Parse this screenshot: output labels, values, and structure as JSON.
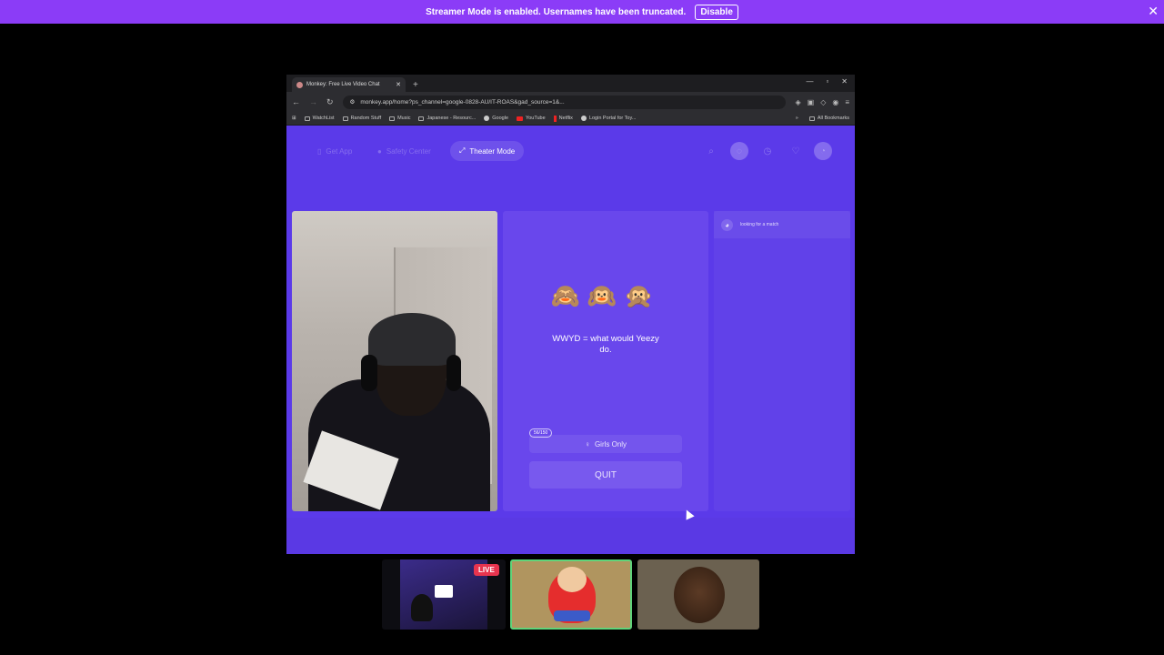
{
  "banner": {
    "message": "Streamer Mode is enabled. Usernames have been truncated.",
    "disable_label": "Disable",
    "close": "✕"
  },
  "browser": {
    "tab_title": "Monkey: Free Live Video Chat",
    "new_tab": "+",
    "url": "monkey.app/home?ps_channel=google-0828-AU/IT-ROAS&gad_source=1&...",
    "bookmarks": [
      "WatchList",
      "Random Stuff",
      "Music",
      "Japanese - Resourc...",
      "Google",
      "YouTube",
      "Netflix",
      "Login Portal for Toy..."
    ],
    "all_bookmarks": "All Bookmarks"
  },
  "site": {
    "nav": {
      "get_app": "Get App",
      "safety_center": "Safety Center",
      "theater_mode": "Theater Mode"
    },
    "monkeys": "🙈🙉🙊",
    "tagline": "WWYD = what would Yeezy do.",
    "counter": "56/150",
    "girls_only": "Girls Only",
    "quit": "QUIT",
    "chat_status": "looking for a match"
  },
  "participants": {
    "live_badge": "LIVE"
  },
  "colors": {
    "banner": "#8b3cf7",
    "site_bg": "#5b3ae9",
    "live": "#e8344e",
    "active_border": "#5fd47a"
  }
}
